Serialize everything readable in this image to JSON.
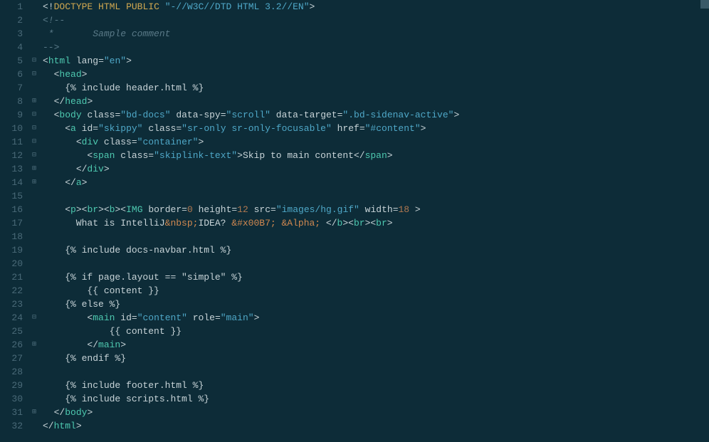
{
  "line_count": 32,
  "fold_marks": {
    "1": "",
    "2": "",
    "3": "",
    "4": "",
    "5": "⊟",
    "6": "⊟",
    "7": "",
    "8": "⊞",
    "9": "⊟",
    "10": "⊟",
    "11": "⊟",
    "12": "⊟",
    "13": "⊞",
    "14": "⊞",
    "24": "⊟",
    "26": "⊞",
    "31": "⊞"
  },
  "code": [
    [
      [
        "t-punc",
        "<!"
      ],
      [
        "t-doctype",
        "DOCTYPE"
      ],
      [
        "t-text",
        " "
      ],
      [
        "t-key",
        "HTML"
      ],
      [
        "t-text",
        " "
      ],
      [
        "t-key",
        "PUBLIC"
      ],
      [
        "t-text",
        " "
      ],
      [
        "t-str",
        "\"-//W3C//DTD HTML 3.2//EN\""
      ],
      [
        "t-punc",
        ">"
      ]
    ],
    [
      [
        "t-comment",
        "<!--"
      ]
    ],
    [
      [
        "t-comment",
        " *       Sample comment"
      ]
    ],
    [
      [
        "t-comment",
        "-->"
      ]
    ],
    [
      [
        "t-punc",
        "<"
      ],
      [
        "t-tag",
        "html"
      ],
      [
        "t-text",
        " "
      ],
      [
        "t-attr",
        "lang"
      ],
      [
        "t-punc",
        "="
      ],
      [
        "t-str",
        "\"en\""
      ],
      [
        "t-punc",
        ">"
      ]
    ],
    [
      [
        "t-text",
        "  "
      ],
      [
        "t-punc",
        "<"
      ],
      [
        "t-tag",
        "head"
      ],
      [
        "t-punc",
        ">"
      ]
    ],
    [
      [
        "t-text",
        "    "
      ],
      [
        "t-text",
        "{% include header.html %}"
      ]
    ],
    [
      [
        "t-text",
        "  "
      ],
      [
        "t-punc",
        "</"
      ],
      [
        "t-tag",
        "head"
      ],
      [
        "t-punc",
        ">"
      ]
    ],
    [
      [
        "t-text",
        "  "
      ],
      [
        "t-punc",
        "<"
      ],
      [
        "t-tag",
        "body"
      ],
      [
        "t-text",
        " "
      ],
      [
        "t-attr",
        "class"
      ],
      [
        "t-punc",
        "="
      ],
      [
        "t-str",
        "\"bd-docs\""
      ],
      [
        "t-text",
        " "
      ],
      [
        "t-attr",
        "data-spy"
      ],
      [
        "t-punc",
        "="
      ],
      [
        "t-str",
        "\"scroll\""
      ],
      [
        "t-text",
        " "
      ],
      [
        "t-attr",
        "data-target"
      ],
      [
        "t-punc",
        "="
      ],
      [
        "t-str",
        "\".bd-sidenav-active\""
      ],
      [
        "t-punc",
        ">"
      ]
    ],
    [
      [
        "t-text",
        "    "
      ],
      [
        "t-punc",
        "<"
      ],
      [
        "t-tag",
        "a"
      ],
      [
        "t-text",
        " "
      ],
      [
        "t-attr",
        "id"
      ],
      [
        "t-punc",
        "="
      ],
      [
        "t-str",
        "\"skippy\""
      ],
      [
        "t-text",
        " "
      ],
      [
        "t-attr",
        "class"
      ],
      [
        "t-punc",
        "="
      ],
      [
        "t-str",
        "\"sr-only sr-only-focusable\""
      ],
      [
        "t-text",
        " "
      ],
      [
        "t-attr",
        "href"
      ],
      [
        "t-punc",
        "="
      ],
      [
        "t-str",
        "\"#content\""
      ],
      [
        "t-punc",
        ">"
      ]
    ],
    [
      [
        "t-text",
        "      "
      ],
      [
        "t-punc",
        "<"
      ],
      [
        "t-tag",
        "div"
      ],
      [
        "t-text",
        " "
      ],
      [
        "t-attr",
        "class"
      ],
      [
        "t-punc",
        "="
      ],
      [
        "t-str",
        "\"container\""
      ],
      [
        "t-punc",
        ">"
      ]
    ],
    [
      [
        "t-text",
        "        "
      ],
      [
        "t-punc",
        "<"
      ],
      [
        "t-tag",
        "span"
      ],
      [
        "t-text",
        " "
      ],
      [
        "t-attr",
        "class"
      ],
      [
        "t-punc",
        "="
      ],
      [
        "t-str",
        "\"skiplink-text\""
      ],
      [
        "t-punc",
        ">"
      ],
      [
        "t-text",
        "Skip to main content"
      ],
      [
        "t-punc",
        "</"
      ],
      [
        "t-tag",
        "span"
      ],
      [
        "t-punc",
        ">"
      ]
    ],
    [
      [
        "t-text",
        "      "
      ],
      [
        "t-punc",
        "</"
      ],
      [
        "t-tag",
        "div"
      ],
      [
        "t-punc",
        ">"
      ]
    ],
    [
      [
        "t-text",
        "    "
      ],
      [
        "t-punc",
        "</"
      ],
      [
        "t-tag",
        "a"
      ],
      [
        "t-punc",
        ">"
      ]
    ],
    [
      [
        "t-text",
        ""
      ]
    ],
    [
      [
        "t-text",
        "    "
      ],
      [
        "t-punc",
        "<"
      ],
      [
        "t-tag",
        "p"
      ],
      [
        "t-punc",
        "><"
      ],
      [
        "t-tag",
        "br"
      ],
      [
        "t-punc",
        "><"
      ],
      [
        "t-tag",
        "b"
      ],
      [
        "t-punc",
        "><"
      ],
      [
        "t-tag",
        "IMG"
      ],
      [
        "t-text",
        " "
      ],
      [
        "t-attr",
        "border"
      ],
      [
        "t-punc",
        "="
      ],
      [
        "t-num",
        "0"
      ],
      [
        "t-text",
        " "
      ],
      [
        "t-attr",
        "height"
      ],
      [
        "t-punc",
        "="
      ],
      [
        "t-num",
        "12"
      ],
      [
        "t-text",
        " "
      ],
      [
        "t-attr",
        "src"
      ],
      [
        "t-punc",
        "="
      ],
      [
        "t-str",
        "\"images/hg.gif\""
      ],
      [
        "t-text",
        " "
      ],
      [
        "t-attr",
        "width"
      ],
      [
        "t-punc",
        "="
      ],
      [
        "t-num",
        "18"
      ],
      [
        "t-text",
        " "
      ],
      [
        "t-punc",
        ">"
      ]
    ],
    [
      [
        "t-text",
        "      What is IntelliJ"
      ],
      [
        "t-entity",
        "&nbsp;"
      ],
      [
        "t-text",
        "IDEA? "
      ],
      [
        "t-entity",
        "&#x00B7;"
      ],
      [
        "t-text",
        " "
      ],
      [
        "t-entity",
        "&Alpha;"
      ],
      [
        "t-text",
        " "
      ],
      [
        "t-punc",
        "</"
      ],
      [
        "t-tag",
        "b"
      ],
      [
        "t-punc",
        "><"
      ],
      [
        "t-tag",
        "br"
      ],
      [
        "t-punc",
        "><"
      ],
      [
        "t-tag",
        "br"
      ],
      [
        "t-punc",
        ">"
      ]
    ],
    [
      [
        "t-text",
        ""
      ]
    ],
    [
      [
        "t-text",
        "    "
      ],
      [
        "t-text",
        "{% include docs-navbar.html %}"
      ]
    ],
    [
      [
        "t-text",
        ""
      ]
    ],
    [
      [
        "t-text",
        "    "
      ],
      [
        "t-text",
        "{% if page.layout == \"simple\" %}"
      ]
    ],
    [
      [
        "t-text",
        "        "
      ],
      [
        "t-text",
        "{{ content }}"
      ]
    ],
    [
      [
        "t-text",
        "    "
      ],
      [
        "t-text",
        "{% else %}"
      ]
    ],
    [
      [
        "t-text",
        "        "
      ],
      [
        "t-punc",
        "<"
      ],
      [
        "t-tag",
        "main"
      ],
      [
        "t-text",
        " "
      ],
      [
        "t-attr",
        "id"
      ],
      [
        "t-punc",
        "="
      ],
      [
        "t-str",
        "\"content\""
      ],
      [
        "t-text",
        " "
      ],
      [
        "t-attr",
        "role"
      ],
      [
        "t-punc",
        "="
      ],
      [
        "t-str",
        "\"main\""
      ],
      [
        "t-punc",
        ">"
      ]
    ],
    [
      [
        "t-text",
        "            "
      ],
      [
        "t-text",
        "{{ content }}"
      ]
    ],
    [
      [
        "t-text",
        "        "
      ],
      [
        "t-punc",
        "</"
      ],
      [
        "t-tag",
        "main"
      ],
      [
        "t-punc",
        ">"
      ]
    ],
    [
      [
        "t-text",
        "    "
      ],
      [
        "t-text",
        "{% endif %}"
      ]
    ],
    [
      [
        "t-text",
        ""
      ]
    ],
    [
      [
        "t-text",
        "    "
      ],
      [
        "t-text",
        "{% include footer.html %}"
      ]
    ],
    [
      [
        "t-text",
        "    "
      ],
      [
        "t-text",
        "{% include scripts.html %}"
      ]
    ],
    [
      [
        "t-text",
        "  "
      ],
      [
        "t-punc",
        "</"
      ],
      [
        "t-tag",
        "body"
      ],
      [
        "t-punc",
        ">"
      ]
    ],
    [
      [
        "t-punc",
        "</"
      ],
      [
        "t-tag",
        "html"
      ],
      [
        "t-punc",
        ">"
      ]
    ]
  ]
}
